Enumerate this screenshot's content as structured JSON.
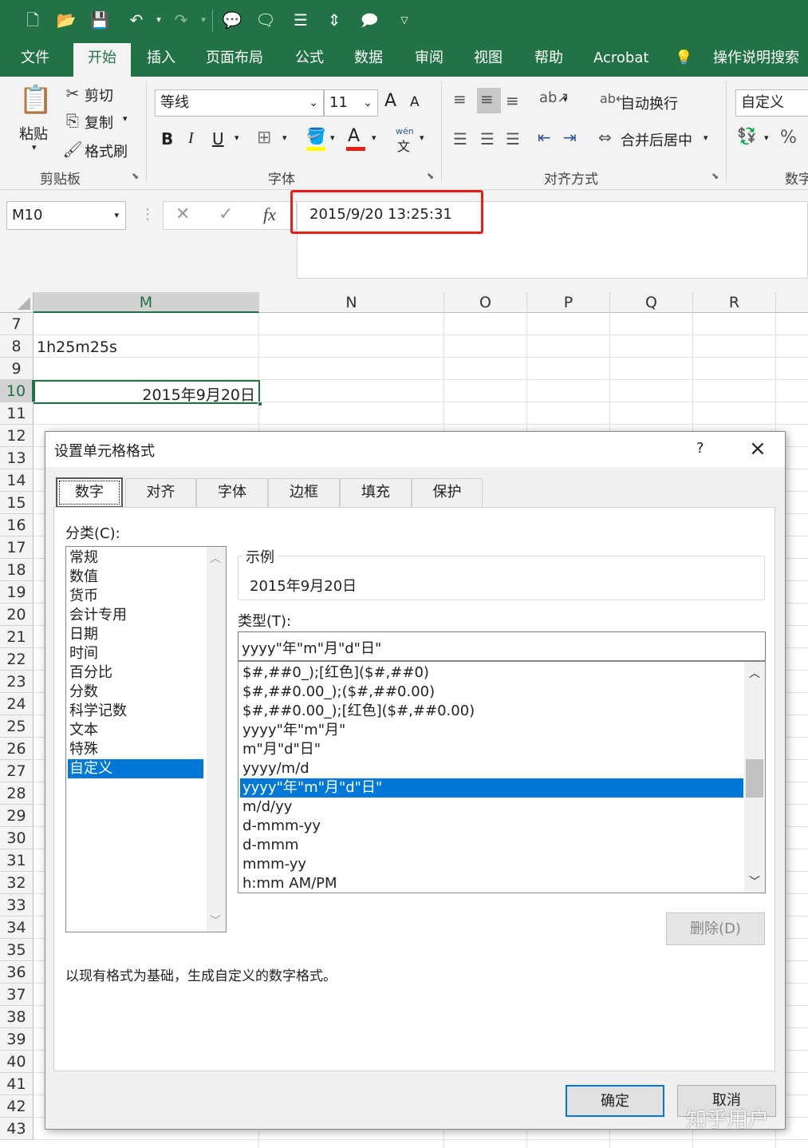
{
  "qat_icons": [
    "new-file-icon",
    "open-folder-icon",
    "save-icon",
    "undo-icon",
    "redo-icon",
    "comment-icon",
    "new-comment-icon",
    "distribute-icon",
    "text-direction-icon",
    "show-comments-icon",
    "customize-dropdown-icon"
  ],
  "tabs": [
    "文件",
    "开始",
    "插入",
    "页面布局",
    "公式",
    "数据",
    "审阅",
    "视图",
    "帮助",
    "Acrobat",
    "操作说明搜索"
  ],
  "ribbon": {
    "clipboard": {
      "paste": "粘贴",
      "cut": "剪切",
      "copy": "复制",
      "format_painter": "格式刷",
      "label": "剪贴板"
    },
    "font": {
      "name": "等线",
      "size": "11",
      "bold": "B",
      "italic": "I",
      "underline": "U",
      "label": "字体",
      "phonetic_top": "wén",
      "phonetic_bottom": "文",
      "grow": "A",
      "shrink": "A"
    },
    "align": {
      "wrap": "自动换行",
      "merge": "合并后居中",
      "label": "对齐方式"
    },
    "number": {
      "format": "自定义",
      "percent": "%",
      "label": "数字"
    }
  },
  "formula_bar": {
    "name_box": "M10",
    "fx": "fx",
    "value": "2015/9/20  13:25:31",
    "highlight_color": "#e32119"
  },
  "sheet": {
    "columns": [
      "M",
      "N",
      "O",
      "P",
      "Q",
      "R"
    ],
    "rows": [
      "7",
      "8",
      "9",
      "10",
      "11",
      "12",
      "13",
      "14",
      "15",
      "16",
      "17",
      "18",
      "19",
      "20",
      "21",
      "22",
      "23",
      "24",
      "25",
      "26",
      "27",
      "28",
      "29",
      "30",
      "31",
      "32",
      "33",
      "34",
      "35",
      "36",
      "37",
      "38",
      "39",
      "40",
      "41",
      "42",
      "43"
    ],
    "cell_m8": "1h25m25s",
    "cell_m10": "2015年9月20日"
  },
  "dialog": {
    "title": "设置单元格格式",
    "help": "?",
    "close": "×",
    "tabs": [
      "数字",
      "对齐",
      "字体",
      "边框",
      "填充",
      "保护"
    ],
    "category_label": "分类(C):",
    "categories": [
      "常规",
      "数值",
      "货币",
      "会计专用",
      "日期",
      "时间",
      "百分比",
      "分数",
      "科学记数",
      "文本",
      "特殊",
      "自定义"
    ],
    "selected_category": "自定义",
    "sample_label": "示例",
    "sample_value": "2015年9月20日",
    "type_label": "类型(T):",
    "type_value": "yyyy\"年\"m\"月\"d\"日\"",
    "formats": [
      "$#,##0_);[红色]($#,##0)",
      "$#,##0.00_);($#,##0.00)",
      "$#,##0.00_);[红色]($#,##0.00)",
      "yyyy\"年\"m\"月\"",
      "m\"月\"d\"日\"",
      "yyyy/m/d",
      "yyyy\"年\"m\"月\"d\"日\"",
      "m/d/yy",
      "d-mmm-yy",
      "d-mmm",
      "mmm-yy",
      "h:mm AM/PM"
    ],
    "selected_format": "yyyy\"年\"m\"月\"d\"日\"",
    "delete_button": "删除(D)",
    "description": "以现有格式为基础，生成自定义的数字格式。",
    "ok": "确定",
    "cancel": "取消"
  },
  "watermark": "知乎用户",
  "colors": {
    "excel_green": "#217346",
    "selection_blue": "#0078d7",
    "red_highlight": "#e32119"
  }
}
